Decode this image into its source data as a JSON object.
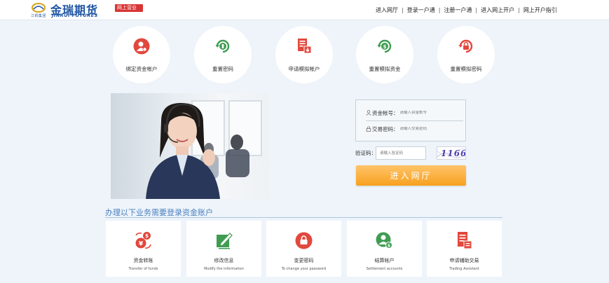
{
  "brand": {
    "name_cn": "金瑞期货",
    "name_en": "JINRUI FUTURES",
    "sub": "江铜集团",
    "badge": "网上营业厅"
  },
  "topnav": [
    "进入网厅",
    "登录一户通",
    "注册一户通",
    "进入网上开户",
    "网上开户指引"
  ],
  "services": [
    {
      "label": "绑定资金帐户",
      "icon": "user-bind-icon"
    },
    {
      "label": "重置密码",
      "icon": "refresh-key-icon"
    },
    {
      "label": "申请模拟帐户",
      "icon": "document-download-icon"
    },
    {
      "label": "重置模拟资金",
      "icon": "refresh-money-icon"
    },
    {
      "label": "重置模拟密码",
      "icon": "refresh-lock-icon"
    }
  ],
  "login": {
    "account_label": "资金帐号：",
    "account_placeholder": "请输入资金帐号",
    "password_label": "交易密码：",
    "password_placeholder": "请输入交易密码",
    "captcha_label": "验证码：",
    "captcha_placeholder": "请输入验证码",
    "captcha_code": "1166",
    "submit_label": "进入网厅"
  },
  "section": {
    "title": "办理以下业务需要登录资金账户",
    "cards": [
      {
        "cn": "资金转账",
        "en": "Transfer of funds",
        "icon": "currency-transfer-icon"
      },
      {
        "cn": "修改信息",
        "en": "Modify the information",
        "icon": "edit-icon"
      },
      {
        "cn": "变更密码",
        "en": "To change your password",
        "icon": "lock-icon"
      },
      {
        "cn": "结算帐户",
        "en": "Settlement accounts",
        "icon": "user-money-icon"
      },
      {
        "cn": "申请辅助交易",
        "en": "Trading Assistant",
        "icon": "document-list-icon"
      }
    ]
  },
  "colors": {
    "brand_blue": "#1d54a3",
    "icon_red": "#e2483d",
    "icon_green": "#3f9d52",
    "button_orange": "#f7a11f",
    "section_blue": "#4a7fc1"
  }
}
